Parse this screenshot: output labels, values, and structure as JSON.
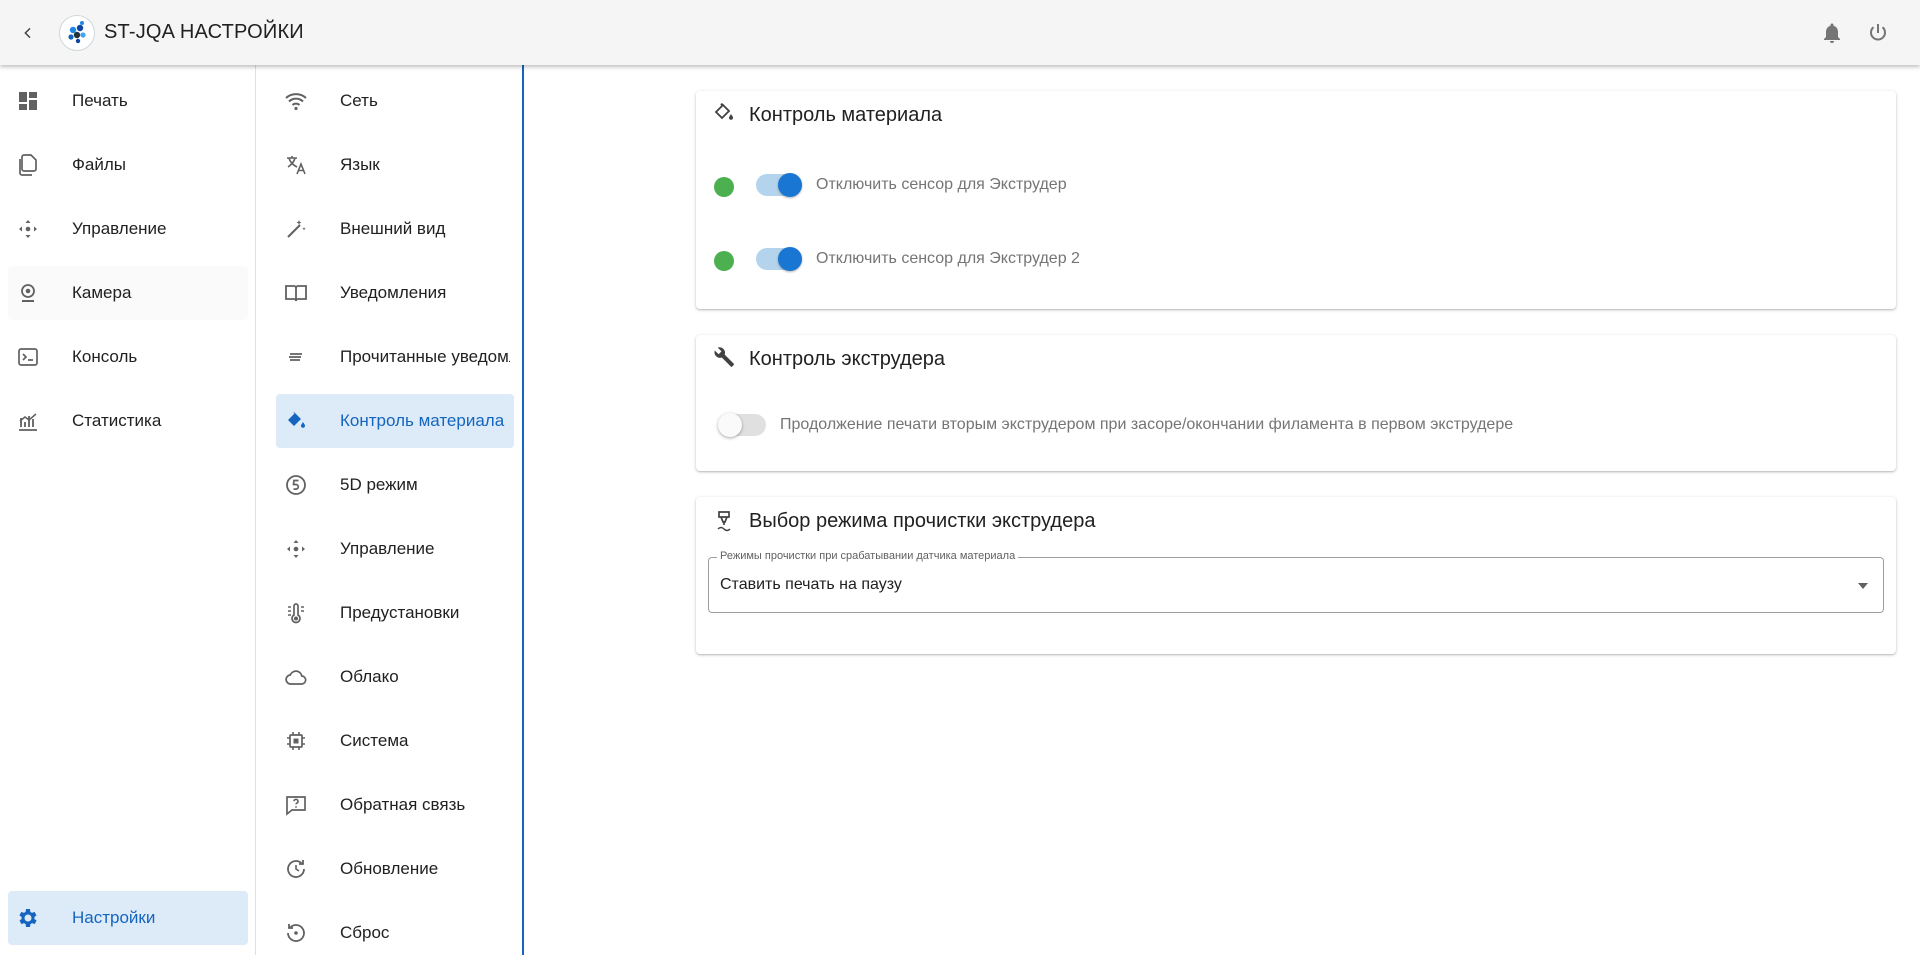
{
  "header": {
    "device_name": "ST-JQA",
    "section_title": "НАСТРОЙКИ"
  },
  "sidebar": {
    "items": [
      {
        "label": "Печать",
        "icon": "dashboard-icon"
      },
      {
        "label": "Файлы",
        "icon": "files-icon"
      },
      {
        "label": "Управление",
        "icon": "move-arrows-icon"
      },
      {
        "label": "Камера",
        "icon": "webcam-icon"
      },
      {
        "label": "Консоль",
        "icon": "console-icon"
      },
      {
        "label": "Статистика",
        "icon": "chart-icon"
      }
    ],
    "settings_label": "Настройки"
  },
  "settings_menu": {
    "items": [
      {
        "label": "Сеть",
        "icon": "wifi-icon"
      },
      {
        "label": "Язык",
        "icon": "translate-icon"
      },
      {
        "label": "Внешний вид",
        "icon": "magic-wand-icon"
      },
      {
        "label": "Уведомления",
        "icon": "book-icon"
      },
      {
        "label": "Прочитанные уведомления",
        "icon": "notes-icon"
      },
      {
        "label": "Контроль материала",
        "icon": "paint-bucket-icon"
      },
      {
        "label": "5D режим",
        "icon": "five-circle-icon"
      },
      {
        "label": "Управление",
        "icon": "move-arrows-icon"
      },
      {
        "label": "Предустановки",
        "icon": "thermometer-icon"
      },
      {
        "label": "Облако",
        "icon": "cloud-icon"
      },
      {
        "label": "Система",
        "icon": "chip-icon"
      },
      {
        "label": "Обратная связь",
        "icon": "feedback-icon"
      },
      {
        "label": "Обновление",
        "icon": "update-icon"
      },
      {
        "label": "Сброс",
        "icon": "reset-icon"
      }
    ],
    "active_index": 5
  },
  "material_card": {
    "title": "Контроль материала",
    "sensors": [
      {
        "label": "Отключить сенсор для Экструдер",
        "enabled": true,
        "status_color": "#4caf50"
      },
      {
        "label": "Отключить сенсор для Экструдер 2",
        "enabled": true,
        "status_color": "#4caf50"
      }
    ]
  },
  "extruder_card": {
    "title": "Контроль экструдера",
    "toggle_label": "Продолжение печати вторым экструдером при засоре/окончании филамента в первом экструдере",
    "toggle_enabled": false
  },
  "purge_card": {
    "title": "Выбор режима прочистки экструдера",
    "select_label": "Режимы прочистки при срабатывании датчика материала",
    "select_value": "Ставить печать на паузу"
  },
  "colors": {
    "accent": "#1565c0",
    "active_bg": "#dcebf7",
    "status_ok": "#4caf50"
  }
}
